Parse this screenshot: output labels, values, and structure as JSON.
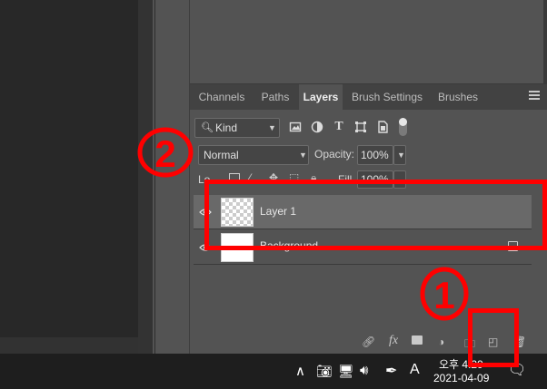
{
  "tabs": [
    {
      "label": "Channels",
      "active": false
    },
    {
      "label": "Paths",
      "active": false
    },
    {
      "label": "Layers",
      "active": true
    },
    {
      "label": "Brush Settings",
      "active": false
    },
    {
      "label": "Brushes",
      "active": false
    }
  ],
  "filter": {
    "kind_label": "Kind"
  },
  "blend": {
    "mode": "Normal",
    "opacity_label": "Opacity:",
    "opacity_value": "100%"
  },
  "lock_row": {
    "lock_label": "Lo",
    "fill_label": "Fill",
    "fill_value": "100%"
  },
  "layers": [
    {
      "name": "Layer 1",
      "selected": true,
      "thumbnail": "transparent"
    },
    {
      "name": "Background",
      "selected": false,
      "thumbnail": "white",
      "locked": true
    }
  ],
  "footer": {
    "fx_label": "fx"
  },
  "taskbar": {
    "time": "오후 4:29",
    "date": "2021-04-09",
    "ime_label": "A"
  },
  "annotations": {
    "circle_1": "1",
    "circle_2": "2"
  },
  "colors": {
    "annotation": "#ff0000",
    "panel": "#535353",
    "tabbar": "#424242",
    "selected_row": "#696969"
  }
}
